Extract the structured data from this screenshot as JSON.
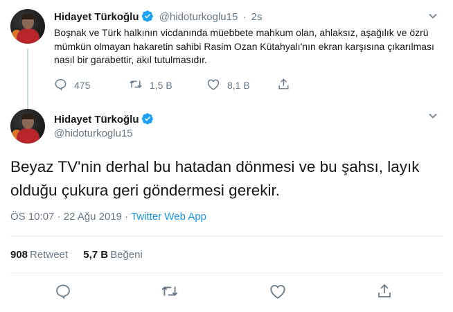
{
  "tweet1": {
    "author_name": "Hidayet Türkoğlu",
    "handle": "@hidoturkoglu15",
    "separator": "·",
    "time_ago": "2s",
    "text": "Boşnak ve Türk halkının vicdanında müebbete mahkum olan, ahlaksız, aşağılık ve özrü mümkün olmayan hakaretin sahibi Rasim Ozan Kütahyalı'nın ekran karşısına çıkarılması nasıl bir garabettir, akıl tutulmasıdır.",
    "replies": "475",
    "retweets": "1,5 B",
    "likes": "8,1 B"
  },
  "tweet2": {
    "author_name": "Hidayet Türkoğlu",
    "handle": "@hidoturkoglu15",
    "text": "Beyaz TV'nin derhal bu hatadan dönmesi ve bu şahsı, layık olduğu çukura geri göndermesi gerekir.",
    "time": "ÖS 10:07",
    "date_separator": "·",
    "date": "22 Ağu 2019",
    "source_separator": "·",
    "source": "Twitter Web App",
    "retweet_count": "908",
    "retweet_label": "Retweet",
    "like_count": "5,7 B",
    "like_label": "Beğeni"
  },
  "colors": {
    "accent": "#1da1f2",
    "link": "#1b95e0",
    "muted": "#657786",
    "text": "#14171a",
    "divider": "#e6ecf0"
  },
  "icons": [
    "verified-badge-icon",
    "chevron-down-icon",
    "reply-icon",
    "retweet-icon",
    "like-icon",
    "share-icon"
  ]
}
